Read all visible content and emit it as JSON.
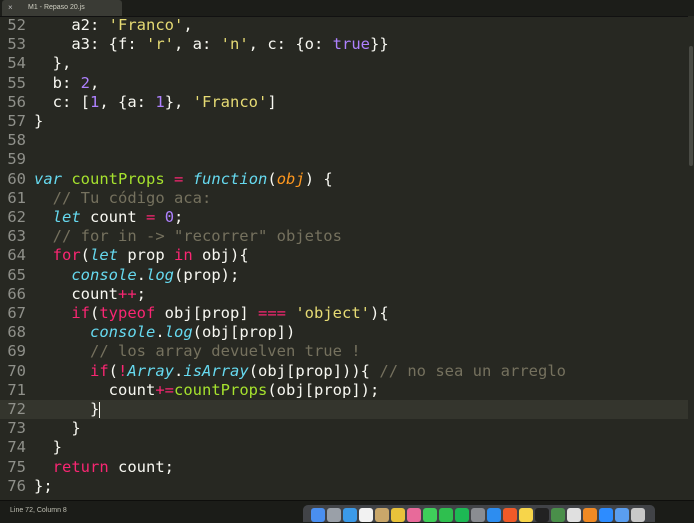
{
  "tab": {
    "title": "M1 - Repaso 20.js",
    "close_glyph": "×"
  },
  "status": {
    "text": "Line 72, Column 8"
  },
  "current_line": 72,
  "lines": [
    {
      "n": "52",
      "t": [
        [
          "pl",
          "    a2: "
        ],
        [
          "str",
          "'Franco'"
        ],
        [
          "pl",
          ","
        ]
      ]
    },
    {
      "n": "53",
      "t": [
        [
          "pl",
          "    a3: {f: "
        ],
        [
          "str",
          "'r'"
        ],
        [
          "pl",
          ", a: "
        ],
        [
          "str",
          "'n'"
        ],
        [
          "pl",
          ", c: {o: "
        ],
        [
          "num",
          "true"
        ],
        [
          "pl",
          "}}"
        ]
      ]
    },
    {
      "n": "54",
      "t": [
        [
          "pl",
          "  },"
        ]
      ]
    },
    {
      "n": "55",
      "t": [
        [
          "pl",
          "  b: "
        ],
        [
          "num",
          "2"
        ],
        [
          "pl",
          ","
        ]
      ]
    },
    {
      "n": "56",
      "t": [
        [
          "pl",
          "  c: ["
        ],
        [
          "num",
          "1"
        ],
        [
          "pl",
          ", {a: "
        ],
        [
          "num",
          "1"
        ],
        [
          "pl",
          "}, "
        ],
        [
          "str",
          "'Franco'"
        ],
        [
          "pl",
          "]"
        ]
      ]
    },
    {
      "n": "57",
      "t": [
        [
          "pl",
          "}"
        ]
      ]
    },
    {
      "n": "58",
      "t": []
    },
    {
      "n": "59",
      "t": []
    },
    {
      "n": "60",
      "t": [
        [
          "st",
          "var"
        ],
        [
          "pl",
          " "
        ],
        [
          "fn",
          "countProps"
        ],
        [
          "pl",
          " "
        ],
        [
          "kw",
          "="
        ],
        [
          "pl",
          " "
        ],
        [
          "st",
          "function"
        ],
        [
          "pl",
          "("
        ],
        [
          "prm",
          "obj"
        ],
        [
          "pl",
          ") {"
        ]
      ]
    },
    {
      "n": "61",
      "t": [
        [
          "cmt",
          "  // Tu código aca:"
        ]
      ]
    },
    {
      "n": "62",
      "t": [
        [
          "pl",
          "  "
        ],
        [
          "st",
          "let"
        ],
        [
          "pl",
          " count "
        ],
        [
          "kw",
          "="
        ],
        [
          "pl",
          " "
        ],
        [
          "num",
          "0"
        ],
        [
          "pl",
          ";"
        ]
      ]
    },
    {
      "n": "63",
      "t": [
        [
          "cmt",
          "  // for in -> \"recorrer\" objetos"
        ]
      ]
    },
    {
      "n": "64",
      "t": [
        [
          "pl",
          "  "
        ],
        [
          "kw",
          "for"
        ],
        [
          "pl",
          "("
        ],
        [
          "st",
          "let"
        ],
        [
          "pl",
          " prop "
        ],
        [
          "kw",
          "in"
        ],
        [
          "pl",
          " obj){"
        ]
      ]
    },
    {
      "n": "65",
      "t": [
        [
          "pl",
          "    "
        ],
        [
          "st",
          "console"
        ],
        [
          "pl",
          "."
        ],
        [
          "st",
          "log"
        ],
        [
          "pl",
          "(prop);"
        ]
      ]
    },
    {
      "n": "66",
      "t": [
        [
          "pl",
          "    count"
        ],
        [
          "kw",
          "++"
        ],
        [
          "pl",
          ";"
        ]
      ]
    },
    {
      "n": "67",
      "t": [
        [
          "pl",
          "    "
        ],
        [
          "kw",
          "if"
        ],
        [
          "pl",
          "("
        ],
        [
          "kw",
          "typeof"
        ],
        [
          "pl",
          " obj[prop] "
        ],
        [
          "kw",
          "==="
        ],
        [
          "pl",
          " "
        ],
        [
          "str",
          "'object'"
        ],
        [
          "pl",
          "){"
        ]
      ]
    },
    {
      "n": "68",
      "t": [
        [
          "pl",
          "      "
        ],
        [
          "st",
          "console"
        ],
        [
          "pl",
          "."
        ],
        [
          "st",
          "log"
        ],
        [
          "pl",
          "(obj[prop])"
        ]
      ]
    },
    {
      "n": "69",
      "t": [
        [
          "cmt",
          "      // los array devuelven true !"
        ]
      ]
    },
    {
      "n": "70",
      "t": [
        [
          "pl",
          "      "
        ],
        [
          "kw",
          "if"
        ],
        [
          "pl",
          "("
        ],
        [
          "kw",
          "!"
        ],
        [
          "st",
          "Array"
        ],
        [
          "pl",
          "."
        ],
        [
          "st",
          "isArray"
        ],
        [
          "pl",
          "(obj[prop])){ "
        ],
        [
          "cmt",
          "// no sea un arreglo"
        ]
      ]
    },
    {
      "n": "71",
      "t": [
        [
          "pl",
          "        count"
        ],
        [
          "kw",
          "+="
        ],
        [
          "fn",
          "countProps"
        ],
        [
          "pl",
          "(obj[prop]);"
        ]
      ]
    },
    {
      "n": "72",
      "t": [
        [
          "pl",
          "      }"
        ]
      ]
    },
    {
      "n": "73",
      "t": [
        [
          "pl",
          "    }"
        ]
      ]
    },
    {
      "n": "74",
      "t": [
        [
          "pl",
          "  }"
        ]
      ]
    },
    {
      "n": "75",
      "t": [
        [
          "pl",
          "  "
        ],
        [
          "kw",
          "return"
        ],
        [
          "pl",
          " count;"
        ]
      ]
    },
    {
      "n": "76",
      "t": [
        [
          "pl",
          "};"
        ]
      ]
    }
  ],
  "dock": {
    "icons": [
      {
        "name": "finder-icon",
        "color": "#4a8ff0"
      },
      {
        "name": "launchpad-icon",
        "color": "#9aa0a8"
      },
      {
        "name": "safari-icon",
        "color": "#3b9ae8"
      },
      {
        "name": "calendar-icon",
        "color": "#f2f2f2"
      },
      {
        "name": "preview-icon",
        "color": "#c9a76a"
      },
      {
        "name": "chrome-icon",
        "color": "#e8c23a"
      },
      {
        "name": "photos-icon",
        "color": "#e86a9a"
      },
      {
        "name": "messages-icon",
        "color": "#3fcf5a"
      },
      {
        "name": "facetime-icon",
        "color": "#2fbf4f"
      },
      {
        "name": "spotify-icon",
        "color": "#1db954"
      },
      {
        "name": "system-preferences-icon",
        "color": "#8a8d92"
      },
      {
        "name": "app-store-icon",
        "color": "#2d8df0"
      },
      {
        "name": "brave-icon",
        "color": "#f05a28"
      },
      {
        "name": "notes-icon",
        "color": "#f7d54a"
      },
      {
        "name": "terminal-icon",
        "color": "#222222"
      },
      {
        "name": "activity-monitor-icon",
        "color": "#4a8f4a"
      },
      {
        "name": "slack-icon",
        "color": "#e0e0e0"
      },
      {
        "name": "sublime-text-icon",
        "color": "#f08a24"
      },
      {
        "name": "zoom-icon",
        "color": "#2d8cff"
      },
      {
        "name": "downloads-icon",
        "color": "#5a9ef0"
      },
      {
        "name": "trash-icon",
        "color": "#c8c8c8"
      }
    ]
  }
}
